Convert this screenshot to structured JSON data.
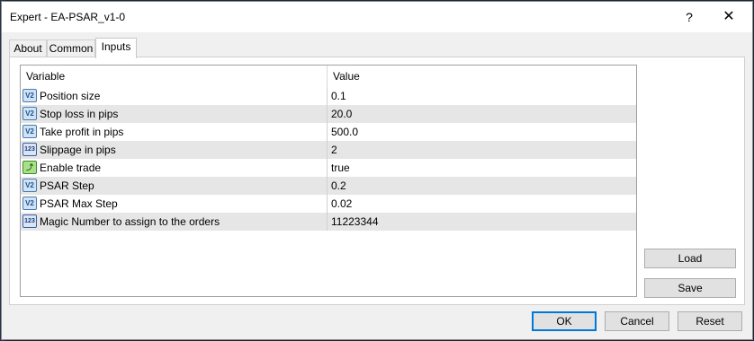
{
  "window": {
    "title": "Expert - EA-PSAR_v1-0",
    "help_label": "?",
    "close_label": "✕"
  },
  "tabs": [
    {
      "label": "About"
    },
    {
      "label": "Common"
    },
    {
      "label": "Inputs",
      "active": true
    }
  ],
  "grid": {
    "columns": [
      "Variable",
      "Value"
    ],
    "rows": [
      {
        "icon": "double-icon",
        "name": "Position size",
        "value": "0.1"
      },
      {
        "icon": "double-icon",
        "name": "Stop loss in pips",
        "value": "20.0"
      },
      {
        "icon": "double-icon",
        "name": "Take profit in pips",
        "value": "500.0"
      },
      {
        "icon": "integer-icon",
        "name": "Slippage in pips",
        "value": "2"
      },
      {
        "icon": "bool-icon",
        "name": "Enable trade",
        "value": "true"
      },
      {
        "icon": "double-icon",
        "name": "PSAR Step",
        "value": "0.2"
      },
      {
        "icon": "double-icon",
        "name": "PSAR Max Step",
        "value": "0.02"
      },
      {
        "icon": "integer-icon",
        "name": "Magic Number to assign to the orders",
        "value": "11223344"
      }
    ]
  },
  "side_buttons": {
    "load": "Load",
    "save": "Save"
  },
  "footer_buttons": {
    "ok": "OK",
    "cancel": "Cancel",
    "reset": "Reset"
  }
}
